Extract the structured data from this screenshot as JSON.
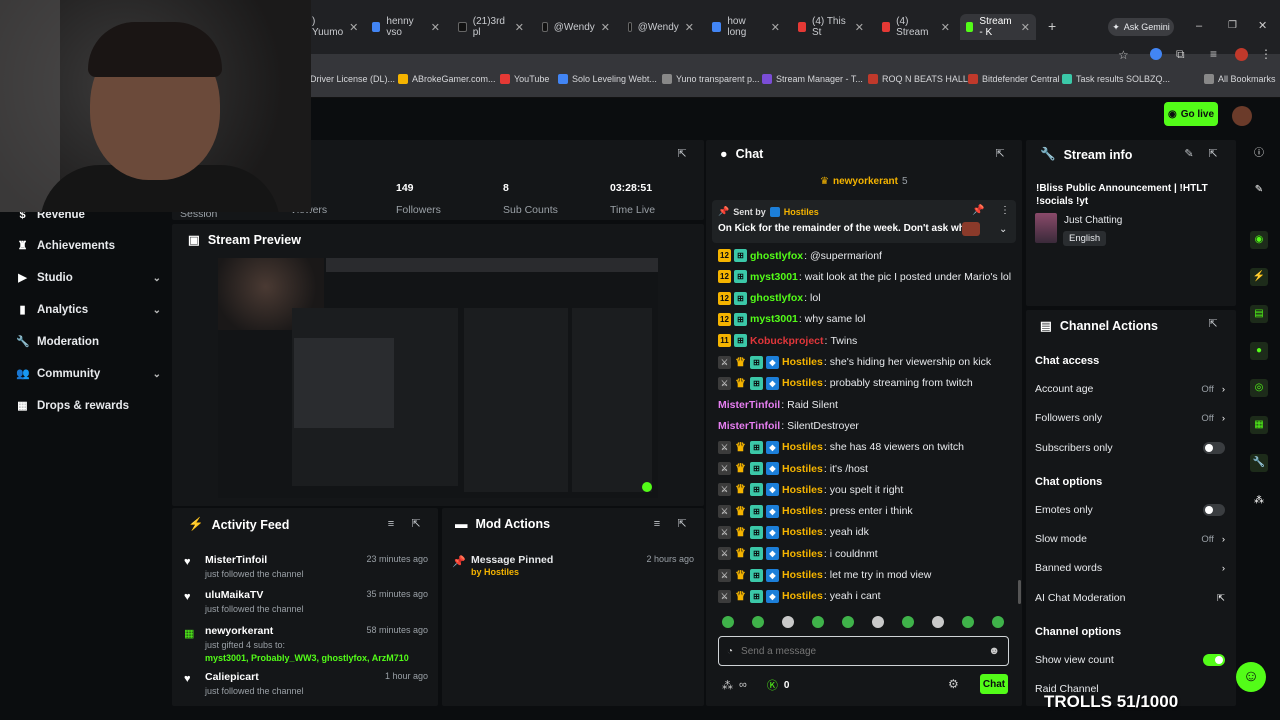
{
  "browser": {
    "tabs": [
      {
        "label": ") Yuumo",
        "favicon": "youtube"
      },
      {
        "label": "henny vso",
        "favicon": "google"
      },
      {
        "label": "(21)3rd pl",
        "favicon": "tiktok"
      },
      {
        "label": "@Wendy",
        "favicon": "tiktok"
      },
      {
        "label": "@Wendy",
        "favicon": "tiktok"
      },
      {
        "label": "how long",
        "favicon": "google"
      },
      {
        "label": "(4) This St",
        "favicon": "youtube"
      },
      {
        "label": "(4) Stream",
        "favicon": "youtube"
      },
      {
        "label": "Stream - K",
        "favicon": "kick"
      }
    ],
    "gemini_label": "Ask Gemini",
    "bookmarks": [
      "Driver License (DL)...",
      "ABrokeGamer.com...",
      "YouTube",
      "Solo Leveling Webt...",
      "Yuno transparent p...",
      "Stream Manager - T...",
      "ROQ N BEATS HALL...",
      "Bitdefender Central",
      "Task results SOLBZQ...",
      "All Bookmarks"
    ]
  },
  "header": {
    "go_live_label": "Go live"
  },
  "sidebar": {
    "items": [
      {
        "label": "Revenue",
        "icon": "dollar-icon"
      },
      {
        "label": "Achievements",
        "icon": "trophy-icon"
      },
      {
        "label": "Studio",
        "icon": "studio-icon",
        "has_chevron": true
      },
      {
        "label": "Analytics",
        "icon": "chart-icon",
        "has_chevron": true
      },
      {
        "label": "Moderation",
        "icon": "wrench-icon"
      },
      {
        "label": "Community",
        "icon": "people-icon",
        "has_chevron": true
      },
      {
        "label": "Drops & rewards",
        "icon": "gift-icon"
      }
    ]
  },
  "stats": {
    "session_label": "Session",
    "viewers_label": "Viewers",
    "followers": {
      "value": "149",
      "label": "Followers"
    },
    "subs": {
      "value": "8",
      "label": "Sub Counts"
    },
    "time": {
      "value": "03:28:51",
      "label": "Time Live"
    }
  },
  "preview": {
    "title": "Stream Preview"
  },
  "activity": {
    "title": "Activity Feed",
    "items": [
      {
        "name": "MisterTinfoil",
        "sub": "just followed the channel",
        "time": "23 minutes ago"
      },
      {
        "name": "uluMaikaTV",
        "sub": "just followed the channel",
        "time": "35 minutes ago"
      },
      {
        "name": "newyorkerant",
        "sub": "just gifted 4 subs to:",
        "gifted": "myst3001, Probably_WW3, ghostlyfox, ArzM710",
        "time": "58 minutes ago"
      },
      {
        "name": "Caliepicart",
        "sub": "just followed the channel",
        "time": "1 hour ago"
      }
    ]
  },
  "mod_actions": {
    "title": "Mod Actions",
    "items": [
      {
        "action": "Message Pinned",
        "by": "by Hostiles",
        "time": "2 hours ago"
      }
    ]
  },
  "chat": {
    "title": "Chat",
    "top_user": "newyorkerant",
    "top_count": "5",
    "pinned": {
      "sent_by": "Sent by",
      "author": "Hostiles",
      "text": "On Kick for the remainder of the week. Don't ask why"
    },
    "messages": [
      {
        "user": "ghostlyfox",
        "color": "#53fc18",
        "text": "@supermarionf",
        "badges": [
          "num12",
          "sub"
        ]
      },
      {
        "user": "myst3001",
        "color": "#53fc18",
        "text": "wait look at the pic I posted under Mario's lol",
        "badges": [
          "num12",
          "sub"
        ]
      },
      {
        "user": "ghostlyfox",
        "color": "#53fc18",
        "text": "lol",
        "badges": [
          "num12",
          "sub"
        ]
      },
      {
        "user": "myst3001",
        "color": "#53fc18",
        "text": "why same lol",
        "badges": [
          "num12",
          "sub"
        ]
      },
      {
        "user": "Kobuckproject",
        "color": "#e0363a",
        "text": "Twins",
        "badges": [
          "num11",
          "sub"
        ]
      },
      {
        "user": "Hostiles",
        "color": "#f5b400",
        "text": "she's hiding her viewership on kick",
        "badges": [
          "mod",
          "crown",
          "sub",
          "vip"
        ]
      },
      {
        "user": "Hostiles",
        "color": "#f5b400",
        "text": "probably streaming from twitch",
        "badges": [
          "mod",
          "crown",
          "sub",
          "vip"
        ]
      },
      {
        "user": "MisterTinfoil",
        "color": "#e67ef0",
        "text": "Raid Silent",
        "badges": []
      },
      {
        "user": "MisterTinfoil",
        "color": "#e67ef0",
        "text": "SilentDestroyer",
        "badges": []
      },
      {
        "user": "Hostiles",
        "color": "#f5b400",
        "text": "she has 48 viewers on twitch",
        "badges": [
          "mod",
          "crown",
          "sub",
          "vip"
        ]
      },
      {
        "user": "Hostiles",
        "color": "#f5b400",
        "text": "it's /host",
        "badges": [
          "mod",
          "crown",
          "sub",
          "vip"
        ]
      },
      {
        "user": "Hostiles",
        "color": "#f5b400",
        "text": "you spelt it right",
        "badges": [
          "mod",
          "crown",
          "sub",
          "vip"
        ]
      },
      {
        "user": "Hostiles",
        "color": "#f5b400",
        "text": "press enter i think",
        "badges": [
          "mod",
          "crown",
          "sub",
          "vip"
        ]
      },
      {
        "user": "Hostiles",
        "color": "#f5b400",
        "text": "yeah idk",
        "badges": [
          "mod",
          "crown",
          "sub",
          "vip"
        ]
      },
      {
        "user": "Hostiles",
        "color": "#f5b400",
        "text": "i couldnmt",
        "badges": [
          "mod",
          "crown",
          "sub",
          "vip"
        ]
      },
      {
        "user": "Hostiles",
        "color": "#f5b400",
        "text": "let me try in mod view",
        "badges": [
          "mod",
          "crown",
          "sub",
          "vip"
        ]
      },
      {
        "user": "Hostiles",
        "color": "#f5b400",
        "text": "yeah i cant",
        "badges": [
          "mod",
          "crown",
          "sub",
          "vip"
        ]
      }
    ],
    "input_placeholder": "Send a message",
    "kicks_count": "0",
    "send_label": "Chat"
  },
  "stream_info": {
    "title_label": "Stream info",
    "stream_title": "!Bliss Public Announcement | !HTLT !socials !yt",
    "category": "Just Chatting",
    "language": "English"
  },
  "channel_actions": {
    "title": "Channel Actions",
    "chat_access_label": "Chat access",
    "account_age": {
      "label": "Account age",
      "value": "Off"
    },
    "followers_only": {
      "label": "Followers only",
      "value": "Off"
    },
    "subscribers_only": {
      "label": "Subscribers only",
      "on": false
    },
    "chat_options_label": "Chat options",
    "emotes_only": {
      "label": "Emotes only",
      "on": false
    },
    "slow_mode": {
      "label": "Slow mode",
      "value": "Off"
    },
    "banned_words": {
      "label": "Banned words"
    },
    "ai_moderation": {
      "label": "AI Chat Moderation"
    },
    "channel_options_label": "Channel options",
    "show_view_count": {
      "label": "Show view count",
      "on": true
    },
    "raid_channel": {
      "label": "Raid Channel"
    }
  },
  "overlay": {
    "trolls_text": "TROLLS 51/1000"
  },
  "colors": {
    "accent": "#53fc18",
    "panel": "#141618",
    "background": "#0b0d0f"
  }
}
